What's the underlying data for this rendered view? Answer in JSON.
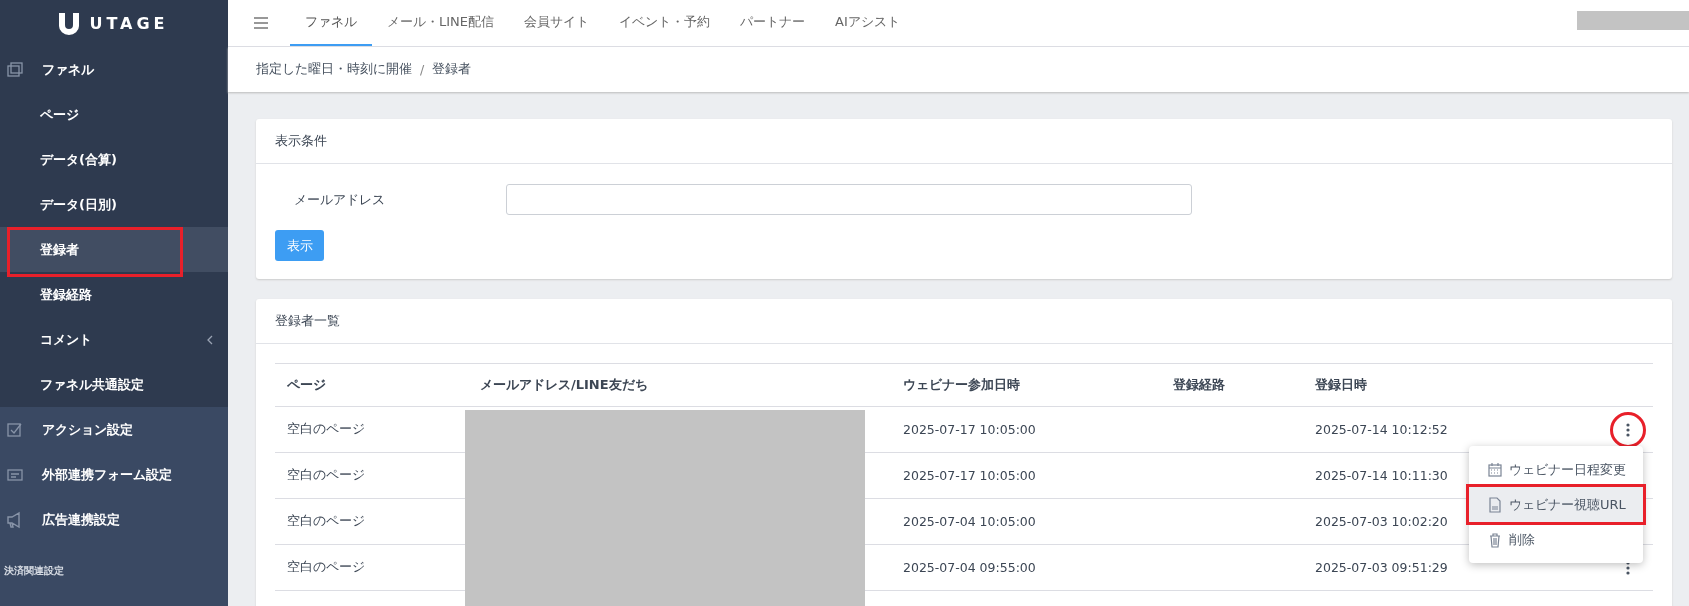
{
  "sidebar": {
    "logo": "UTAGE",
    "groups": [
      {
        "label": "ファネル",
        "children": [
          {
            "label": "ページ",
            "selected": false,
            "highlighted": false,
            "has_submenu": false
          },
          {
            "label": "データ(合算)",
            "selected": false,
            "highlighted": false,
            "has_submenu": false
          },
          {
            "label": "データ(日別)",
            "selected": false,
            "highlighted": false,
            "has_submenu": false
          },
          {
            "label": "登録者",
            "selected": true,
            "highlighted": true,
            "has_submenu": false
          },
          {
            "label": "登録経路",
            "selected": false,
            "highlighted": false,
            "has_submenu": false
          },
          {
            "label": "コメント",
            "selected": false,
            "highlighted": false,
            "has_submenu": true
          },
          {
            "label": "ファネル共通設定",
            "selected": false,
            "highlighted": false,
            "has_submenu": false
          }
        ]
      },
      {
        "label": "アクション設定"
      },
      {
        "label": "外部連携フォーム設定"
      },
      {
        "label": "広告連携設定"
      }
    ],
    "section_label": "決済関連設定"
  },
  "top_tabs": [
    {
      "label": "ファネル",
      "selected": true
    },
    {
      "label": "メール・LINE配信",
      "selected": false
    },
    {
      "label": "会員サイト",
      "selected": false
    },
    {
      "label": "イベント・予約",
      "selected": false
    },
    {
      "label": "パートナー",
      "selected": false
    },
    {
      "label": "AIアシスト",
      "selected": false
    }
  ],
  "breadcrumb": {
    "items": [
      "指定した曜日・時刻に開催",
      "登録者"
    ],
    "separator": "/"
  },
  "filter_card": {
    "title": "表示条件",
    "field_label": "メールアドレス",
    "button": "表示"
  },
  "list_card": {
    "title": "登録者一覧",
    "columns": [
      "ページ",
      "メールアドレス/LINE友だち",
      "ウェビナー参加日時",
      "登録経路",
      "登録日時"
    ],
    "rows": [
      {
        "page": "空白のページ",
        "webinar_date": "2025-07-17 10:05:00",
        "registered": "2025-07-14 10:12:52",
        "menu_button": true,
        "circled": true
      },
      {
        "page": "空白のページ",
        "webinar_date": "2025-07-17 10:05:00",
        "registered": "2025-07-14 10:11:30"
      },
      {
        "page": "空白のページ",
        "webinar_date": "2025-07-04 10:05:00",
        "registered": "2025-07-03 10:02:20"
      },
      {
        "page": "空白のページ",
        "webinar_date": "2025-07-04 09:55:00",
        "registered": "2025-07-03 09:51:29",
        "menu_button": true,
        "circled": false
      }
    ],
    "row_menu": [
      {
        "label": "ウェビナー日程変更",
        "highlighted": false
      },
      {
        "label": "ウェビナー視聴URL",
        "highlighted": true
      },
      {
        "label": "削除",
        "highlighted": false
      }
    ]
  }
}
